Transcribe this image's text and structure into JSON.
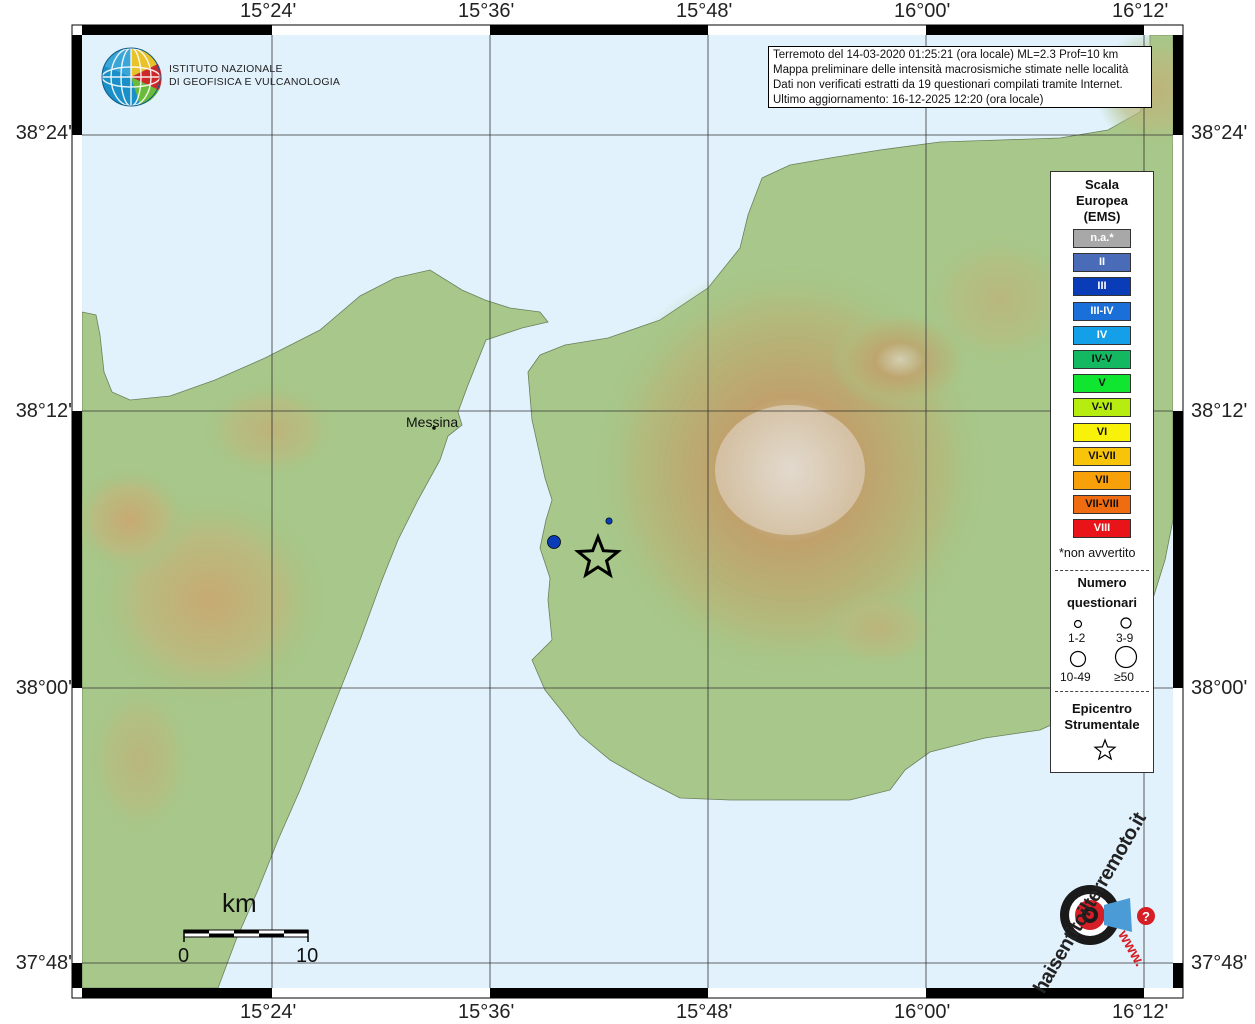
{
  "map": {
    "longitude_ticks": [
      "15°24'",
      "15°36'",
      "15°48'",
      "16°00'",
      "16°12'"
    ],
    "latitude_ticks": [
      "38°24'",
      "38°12'",
      "38°00'",
      "37°48'"
    ],
    "place_label": "Messina",
    "water_color": "#e2f2fc",
    "land_color": "#9ec487",
    "mountain_color": "#c89a5a",
    "epicenter_icon": "star-icon"
  },
  "logo": {
    "line1": "ISTITUTO NAZIONALE",
    "line2": "DI GEOFISICA E VULCANOLOGIA"
  },
  "info": {
    "line1": "Terremoto del 14-03-2020 01:25:21 (ora locale) ML=2.3 Prof=10 km",
    "line2": "Mappa preliminare delle intensità macrosismiche stimate nelle località",
    "line3": "Dati non verificati estratti da 19 questionari compilati tramite Internet.",
    "line4": "Ultimo aggiornamento: 16-12-2025 12:20 (ora locale)"
  },
  "legend": {
    "title_line1": "Scala",
    "title_line2": "Europea",
    "title_line3": "(EMS)",
    "classes": [
      {
        "label": "n.a.*",
        "color": "#a8a8a8",
        "text_color": "#ffffff"
      },
      {
        "label": "II",
        "color": "#4a6cb8",
        "text_color": "#ffffff"
      },
      {
        "label": "III",
        "color": "#0a3cb8",
        "text_color": "#ffffff"
      },
      {
        "label": "III-IV",
        "color": "#1a6fd8",
        "text_color": "#ffffff"
      },
      {
        "label": "IV",
        "color": "#14a0e8",
        "text_color": "#ffffff"
      },
      {
        "label": "IV-V",
        "color": "#14b860",
        "text_color": "#111111"
      },
      {
        "label": "V",
        "color": "#10e630",
        "text_color": "#111111"
      },
      {
        "label": "V-VI",
        "color": "#b6ec10",
        "text_color": "#111111"
      },
      {
        "label": "VI",
        "color": "#f8f20a",
        "text_color": "#111111"
      },
      {
        "label": "VI-VII",
        "color": "#f8c40a",
        "text_color": "#111111"
      },
      {
        "label": "VII",
        "color": "#f8a00a",
        "text_color": "#111111"
      },
      {
        "label": "VII-VIII",
        "color": "#f06c10",
        "text_color": "#111111"
      },
      {
        "label": "VIII",
        "color": "#e8141a",
        "text_color": "#ffffff"
      }
    ],
    "not_felt_note": "*non avvertito",
    "count_title_line1": "Numero",
    "count_title_line2": "questionari",
    "count_ranges": [
      "1-2",
      "3-9",
      "10-49",
      "≥50"
    ],
    "epicenter_title_line1": "Epicentro",
    "epicenter_title_line2": "Strumentale"
  },
  "scalebar": {
    "unit": "km",
    "start": "0",
    "end": "10"
  },
  "brand": {
    "text": "haisentitoilterremoto.it",
    "url": "www."
  }
}
